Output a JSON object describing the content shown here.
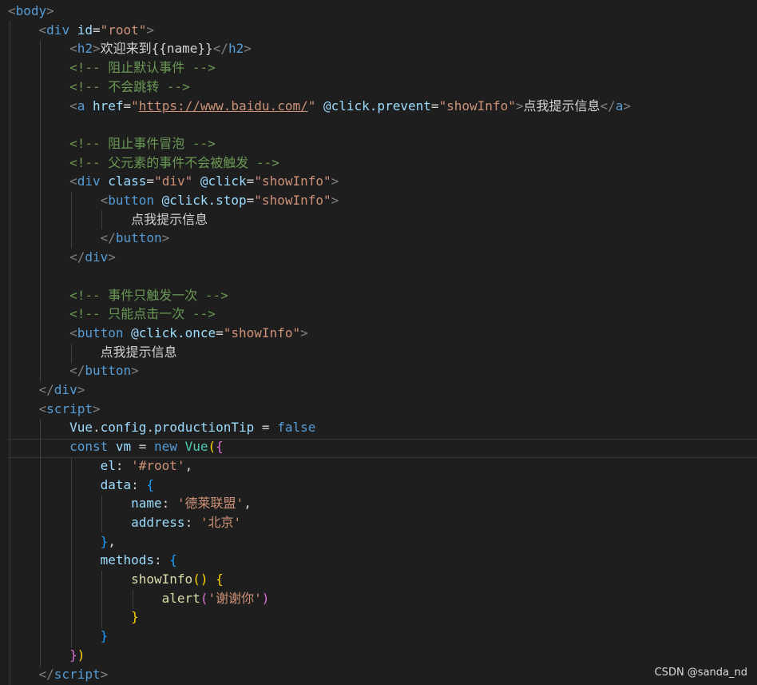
{
  "editor": {
    "theme": {
      "background": "#1e1e1e",
      "tag": "#569cd6",
      "attr": "#9cdcfe",
      "string": "#ce9178",
      "comment": "#6a9955",
      "text": "#d4d4d4"
    },
    "lines": [
      [
        {
          "t": "tag-bracket",
          "v": "<"
        },
        {
          "t": "tag",
          "v": "body"
        },
        {
          "t": "tag-bracket",
          "v": ">"
        }
      ],
      [
        {
          "t": "txt",
          "v": "    "
        },
        {
          "t": "tag-bracket",
          "v": "<"
        },
        {
          "t": "tag",
          "v": "div"
        },
        {
          "t": "txt",
          "v": " "
        },
        {
          "t": "attr",
          "v": "id"
        },
        {
          "t": "txt",
          "v": "="
        },
        {
          "t": "str",
          "v": "\"root\""
        },
        {
          "t": "tag-bracket",
          "v": ">"
        }
      ],
      [
        {
          "t": "txt",
          "v": "        "
        },
        {
          "t": "tag-bracket",
          "v": "<"
        },
        {
          "t": "tag",
          "v": "h2"
        },
        {
          "t": "tag-bracket",
          "v": ">"
        },
        {
          "t": "txt",
          "v": "欢迎来到{{name}}"
        },
        {
          "t": "tag-bracket",
          "v": "</"
        },
        {
          "t": "tag",
          "v": "h2"
        },
        {
          "t": "tag-bracket",
          "v": ">"
        }
      ],
      [
        {
          "t": "txt",
          "v": "        "
        },
        {
          "t": "cmt",
          "v": "<!-- 阻止默认事件 -->"
        }
      ],
      [
        {
          "t": "txt",
          "v": "        "
        },
        {
          "t": "cmt",
          "v": "<!-- 不会跳转 -->"
        }
      ],
      [
        {
          "t": "txt",
          "v": "        "
        },
        {
          "t": "tag-bracket",
          "v": "<"
        },
        {
          "t": "tag",
          "v": "a"
        },
        {
          "t": "txt",
          "v": " "
        },
        {
          "t": "attr",
          "v": "href"
        },
        {
          "t": "txt",
          "v": "="
        },
        {
          "t": "str",
          "v": "\""
        },
        {
          "t": "url",
          "v": "https://www.baidu.com/"
        },
        {
          "t": "str",
          "v": "\""
        },
        {
          "t": "txt",
          "v": " "
        },
        {
          "t": "attr",
          "v": "@click.prevent"
        },
        {
          "t": "txt",
          "v": "="
        },
        {
          "t": "str",
          "v": "\"showInfo\""
        },
        {
          "t": "tag-bracket",
          "v": ">"
        },
        {
          "t": "txt",
          "v": "点我提示信息"
        },
        {
          "t": "tag-bracket",
          "v": "</"
        },
        {
          "t": "tag",
          "v": "a"
        },
        {
          "t": "tag-bracket",
          "v": ">"
        }
      ],
      [],
      [
        {
          "t": "txt",
          "v": "        "
        },
        {
          "t": "cmt",
          "v": "<!-- 阻止事件冒泡 -->"
        }
      ],
      [
        {
          "t": "txt",
          "v": "        "
        },
        {
          "t": "cmt",
          "v": "<!-- 父元素的事件不会被触发 -->"
        }
      ],
      [
        {
          "t": "txt",
          "v": "        "
        },
        {
          "t": "tag-bracket",
          "v": "<"
        },
        {
          "t": "tag",
          "v": "div"
        },
        {
          "t": "txt",
          "v": " "
        },
        {
          "t": "attr",
          "v": "class"
        },
        {
          "t": "txt",
          "v": "="
        },
        {
          "t": "str",
          "v": "\"div\""
        },
        {
          "t": "txt",
          "v": " "
        },
        {
          "t": "attr",
          "v": "@click"
        },
        {
          "t": "txt",
          "v": "="
        },
        {
          "t": "str",
          "v": "\"showInfo\""
        },
        {
          "t": "tag-bracket",
          "v": ">"
        }
      ],
      [
        {
          "t": "txt",
          "v": "            "
        },
        {
          "t": "tag-bracket",
          "v": "<"
        },
        {
          "t": "tag",
          "v": "button"
        },
        {
          "t": "txt",
          "v": " "
        },
        {
          "t": "attr",
          "v": "@click.stop"
        },
        {
          "t": "txt",
          "v": "="
        },
        {
          "t": "str",
          "v": "\"showInfo\""
        },
        {
          "t": "tag-bracket",
          "v": ">"
        }
      ],
      [
        {
          "t": "txt",
          "v": "                点我提示信息"
        }
      ],
      [
        {
          "t": "txt",
          "v": "            "
        },
        {
          "t": "tag-bracket",
          "v": "</"
        },
        {
          "t": "tag",
          "v": "button"
        },
        {
          "t": "tag-bracket",
          "v": ">"
        }
      ],
      [
        {
          "t": "txt",
          "v": "        "
        },
        {
          "t": "tag-bracket",
          "v": "</"
        },
        {
          "t": "tag",
          "v": "div"
        },
        {
          "t": "tag-bracket",
          "v": ">"
        }
      ],
      [],
      [
        {
          "t": "txt",
          "v": "        "
        },
        {
          "t": "cmt",
          "v": "<!-- 事件只触发一次 -->"
        }
      ],
      [
        {
          "t": "txt",
          "v": "        "
        },
        {
          "t": "cmt",
          "v": "<!-- 只能点击一次 -->"
        }
      ],
      [
        {
          "t": "txt",
          "v": "        "
        },
        {
          "t": "tag-bracket",
          "v": "<"
        },
        {
          "t": "tag",
          "v": "button"
        },
        {
          "t": "txt",
          "v": " "
        },
        {
          "t": "attr",
          "v": "@click.once"
        },
        {
          "t": "txt",
          "v": "="
        },
        {
          "t": "str",
          "v": "\"showInfo\""
        },
        {
          "t": "tag-bracket",
          "v": ">"
        }
      ],
      [
        {
          "t": "txt",
          "v": "            点我提示信息"
        }
      ],
      [
        {
          "t": "txt",
          "v": "        "
        },
        {
          "t": "tag-bracket",
          "v": "</"
        },
        {
          "t": "tag",
          "v": "button"
        },
        {
          "t": "tag-bracket",
          "v": ">"
        }
      ],
      [
        {
          "t": "txt",
          "v": "    "
        },
        {
          "t": "tag-bracket",
          "v": "</"
        },
        {
          "t": "tag",
          "v": "div"
        },
        {
          "t": "tag-bracket",
          "v": ">"
        }
      ],
      [
        {
          "t": "txt",
          "v": "    "
        },
        {
          "t": "tag-bracket",
          "v": "<"
        },
        {
          "t": "tag",
          "v": "script"
        },
        {
          "t": "tag-bracket",
          "v": ">"
        }
      ],
      [
        {
          "t": "txt",
          "v": "        "
        },
        {
          "t": "prop",
          "v": "Vue"
        },
        {
          "t": "txt",
          "v": "."
        },
        {
          "t": "prop",
          "v": "config"
        },
        {
          "t": "txt",
          "v": "."
        },
        {
          "t": "prop",
          "v": "productionTip"
        },
        {
          "t": "txt",
          "v": " = "
        },
        {
          "t": "kw",
          "v": "false"
        }
      ],
      [
        {
          "t": "txt",
          "v": "        "
        },
        {
          "t": "kw",
          "v": "const"
        },
        {
          "t": "txt",
          "v": " "
        },
        {
          "t": "prop",
          "v": "vm"
        },
        {
          "t": "txt",
          "v": " = "
        },
        {
          "t": "kw",
          "v": "new"
        },
        {
          "t": "txt",
          "v": " "
        },
        {
          "t": "cls",
          "v": "Vue"
        },
        {
          "t": "b1",
          "v": "("
        },
        {
          "t": "b2",
          "v": "{"
        }
      ],
      [
        {
          "t": "txt",
          "v": "            "
        },
        {
          "t": "prop",
          "v": "el"
        },
        {
          "t": "txt",
          "v": ": "
        },
        {
          "t": "str",
          "v": "'#root'"
        },
        {
          "t": "txt",
          "v": ","
        }
      ],
      [
        {
          "t": "txt",
          "v": "            "
        },
        {
          "t": "prop",
          "v": "data"
        },
        {
          "t": "txt",
          "v": ": "
        },
        {
          "t": "b3",
          "v": "{"
        }
      ],
      [
        {
          "t": "txt",
          "v": "                "
        },
        {
          "t": "prop",
          "v": "name"
        },
        {
          "t": "txt",
          "v": ": "
        },
        {
          "t": "str",
          "v": "'德莱联盟'"
        },
        {
          "t": "txt",
          "v": ","
        }
      ],
      [
        {
          "t": "txt",
          "v": "                "
        },
        {
          "t": "prop",
          "v": "address"
        },
        {
          "t": "txt",
          "v": ": "
        },
        {
          "t": "str",
          "v": "'北京'"
        }
      ],
      [
        {
          "t": "txt",
          "v": "            "
        },
        {
          "t": "b3",
          "v": "}"
        },
        {
          "t": "txt",
          "v": ","
        }
      ],
      [
        {
          "t": "txt",
          "v": "            "
        },
        {
          "t": "prop",
          "v": "methods"
        },
        {
          "t": "txt",
          "v": ": "
        },
        {
          "t": "b3",
          "v": "{"
        }
      ],
      [
        {
          "t": "txt",
          "v": "                "
        },
        {
          "t": "fn",
          "v": "showInfo"
        },
        {
          "t": "b1",
          "v": "()"
        },
        {
          "t": "txt",
          "v": " "
        },
        {
          "t": "b1",
          "v": "{"
        }
      ],
      [
        {
          "t": "txt",
          "v": "                    "
        },
        {
          "t": "fn",
          "v": "alert"
        },
        {
          "t": "b2",
          "v": "("
        },
        {
          "t": "str",
          "v": "'谢谢你'"
        },
        {
          "t": "b2",
          "v": ")"
        }
      ],
      [
        {
          "t": "txt",
          "v": "                "
        },
        {
          "t": "b1",
          "v": "}"
        }
      ],
      [
        {
          "t": "txt",
          "v": "            "
        },
        {
          "t": "b3",
          "v": "}"
        }
      ],
      [
        {
          "t": "txt",
          "v": "        "
        },
        {
          "t": "b2",
          "v": "}"
        },
        {
          "t": "b1",
          "v": ")"
        }
      ],
      [
        {
          "t": "txt",
          "v": "    "
        },
        {
          "t": "tag-bracket",
          "v": "</"
        },
        {
          "t": "tag",
          "v": "script"
        },
        {
          "t": "tag-bracket",
          "v": ">"
        }
      ]
    ]
  },
  "watermark": "CSDN @sanda_nd"
}
